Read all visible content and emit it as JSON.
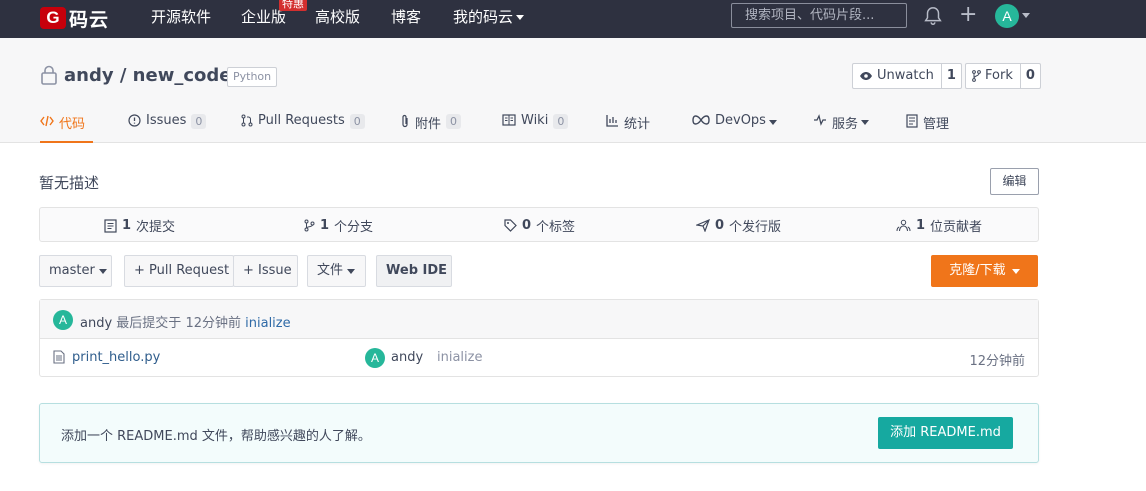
{
  "topnav": {
    "logo_mark": "G",
    "logo_text": "码云",
    "links": [
      "开源软件",
      "企业版",
      "高校版",
      "博客",
      "我的码云"
    ],
    "enterprise_badge": "特惠",
    "search_placeholder": "搜索项目、代码片段...",
    "avatar_letter": "A"
  },
  "project": {
    "title": "andy / new_code",
    "language": "Python",
    "watch_label": "Unwatch",
    "watch_count": "1",
    "fork_label": "Fork",
    "fork_count": "0"
  },
  "tabs": [
    {
      "label": "代码"
    },
    {
      "label": "Issues",
      "count": "0"
    },
    {
      "label": "Pull Requests",
      "count": "0"
    },
    {
      "label": "附件",
      "count": "0"
    },
    {
      "label": "Wiki",
      "count": "0"
    },
    {
      "label": "统计"
    },
    {
      "label": "DevOps"
    },
    {
      "label": "服务"
    },
    {
      "label": "管理"
    }
  ],
  "description": "暂无描述",
  "edit_label": "编辑",
  "stats": [
    {
      "num": "1",
      "label": "次提交"
    },
    {
      "num": "1",
      "label": "个分支"
    },
    {
      "num": "0",
      "label": "个标签"
    },
    {
      "num": "0",
      "label": "个发行版"
    },
    {
      "num": "1",
      "label": "位贡献者"
    }
  ],
  "toolbar": {
    "branch": "master",
    "pull_request": "+ Pull Request",
    "issue": "+ Issue",
    "file": "文件",
    "web_ide": "Web IDE",
    "clone": "克隆/下载"
  },
  "last_commit": {
    "avatar": "A",
    "author": "andy",
    "prefix": "最后提交于",
    "time": "12分钟前",
    "message": "inialize"
  },
  "files": [
    {
      "name": "print_hello.py",
      "avatar": "A",
      "author": "andy",
      "message": "inialize",
      "time": "12分钟前"
    }
  ],
  "readme": {
    "text": "添加一个 README.md 文件，帮助感兴趣的人了解。",
    "button": "添加 README.md"
  }
}
